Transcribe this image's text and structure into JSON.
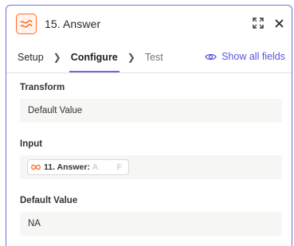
{
  "header": {
    "title": "15. Answer",
    "app_icon": "transform-wave-icon",
    "accent_color": "#ff6a2a"
  },
  "tabs": [
    {
      "label": "Setup"
    },
    {
      "label": "Configure"
    },
    {
      "label": "Test"
    }
  ],
  "show_all_fields_label": "Show all fields",
  "fields": {
    "transform": {
      "label": "Transform",
      "value": "Default Value"
    },
    "input": {
      "label": "Input",
      "pill_step": "11. Answer:",
      "pill_value": "A     F"
    },
    "default_value": {
      "label": "Default Value",
      "value": "NA"
    }
  },
  "colors": {
    "brand_purple": "#6966e8",
    "field_bg": "#f6f6f4"
  }
}
